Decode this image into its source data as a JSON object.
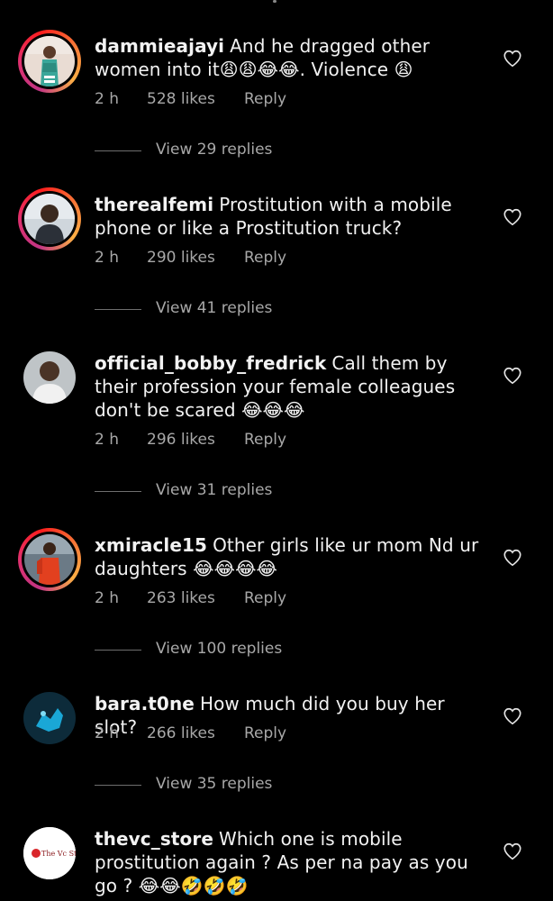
{
  "comments": [
    {
      "username": "dammieajayi",
      "text": "And he dragged other women into it😩😩😂😂. Violence 😩",
      "time": "2 h",
      "likes": "528 likes",
      "reply": "Reply",
      "view_replies": "View 29 replies"
    },
    {
      "username": "therealfemi",
      "text": "Prostitution with a mobile phone or like a Prostitution truck?",
      "time": "2 h",
      "likes": "290 likes",
      "reply": "Reply",
      "view_replies": "View 41 replies"
    },
    {
      "username": "official_bobby_fredrick",
      "text": "Call them by their profession your female colleagues  don't be scared 😂😂😂",
      "time": "2 h",
      "likes": "296 likes",
      "reply": "Reply",
      "view_replies": "View 31 replies"
    },
    {
      "username": "xmiracle15",
      "text": "Other girls like ur mom Nd ur daughters 😂😂😂😂",
      "time": "2 h",
      "likes": "263 likes",
      "reply": "Reply",
      "view_replies": "View 100 replies"
    },
    {
      "username": "bara.t0ne",
      "text": "How much did you buy her slot?",
      "time": "2 h",
      "likes": "266 likes",
      "reply": "Reply",
      "view_replies": "View 35 replies"
    },
    {
      "username": "thevc_store",
      "text": "Which one is mobile prostitution again ? As per na pay as you go ? 😂😂🤣🤣🤣",
      "avatar_logo_text": "The Vc Store"
    }
  ],
  "icons": {
    "like": "heart-outline-icon"
  },
  "colors": {
    "background": "#000000",
    "text": "#f2f2f2",
    "muted": "#a8a8a8",
    "story_ring": "#e1306c"
  }
}
